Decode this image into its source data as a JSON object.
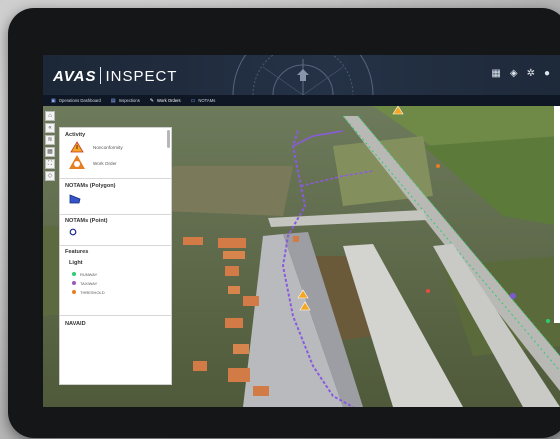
{
  "app": {
    "logo_brand": "AVAS",
    "logo_product": "INSPECT"
  },
  "header": {
    "icons": [
      "apps-grid-icon",
      "layers-icon",
      "settings-gear-icon",
      "user-icon"
    ]
  },
  "nav": {
    "items": [
      {
        "label": "Operations Dashboard",
        "icon": "dashboard-icon"
      },
      {
        "label": "Inspections",
        "icon": "clipboard-icon"
      },
      {
        "label": "Work Orders",
        "icon": "wrench-icon"
      },
      {
        "label": "NOTAMs",
        "icon": "message-icon"
      }
    ]
  },
  "toolbar": {
    "icons": [
      "home-icon",
      "collapse-icon",
      "layers-icon",
      "grid-icon",
      "fullscreen-icon",
      "location-icon"
    ]
  },
  "panel": {
    "activity": {
      "heading": "Activity",
      "items": [
        {
          "label": "Nonconformity",
          "icon": "warning-triangle-icon"
        },
        {
          "label": "Work Order",
          "icon": "work-order-icon"
        }
      ]
    },
    "notams_polygon": {
      "heading": "NOTAMs (Polygon)"
    },
    "notams_point": {
      "heading": "NOTAMs (Point)"
    },
    "features": {
      "heading": "Features",
      "sub_heading": "Light",
      "items": [
        {
          "label": "RUNWAY",
          "color": "#2ecc71"
        },
        {
          "label": "TAXIWAY",
          "color": "#9b59b6"
        },
        {
          "label": "THRESHOLD",
          "color": "#e67e22"
        }
      ]
    },
    "navaid": {
      "heading": "NAVAID"
    }
  },
  "colors": {
    "header_bg": "#1e2a3a",
    "runway_light": "#2ecc71",
    "taxiway_light": "#9b59b6",
    "threshold_light": "#e67e22",
    "taxiway_line": "#8a5ae0"
  }
}
